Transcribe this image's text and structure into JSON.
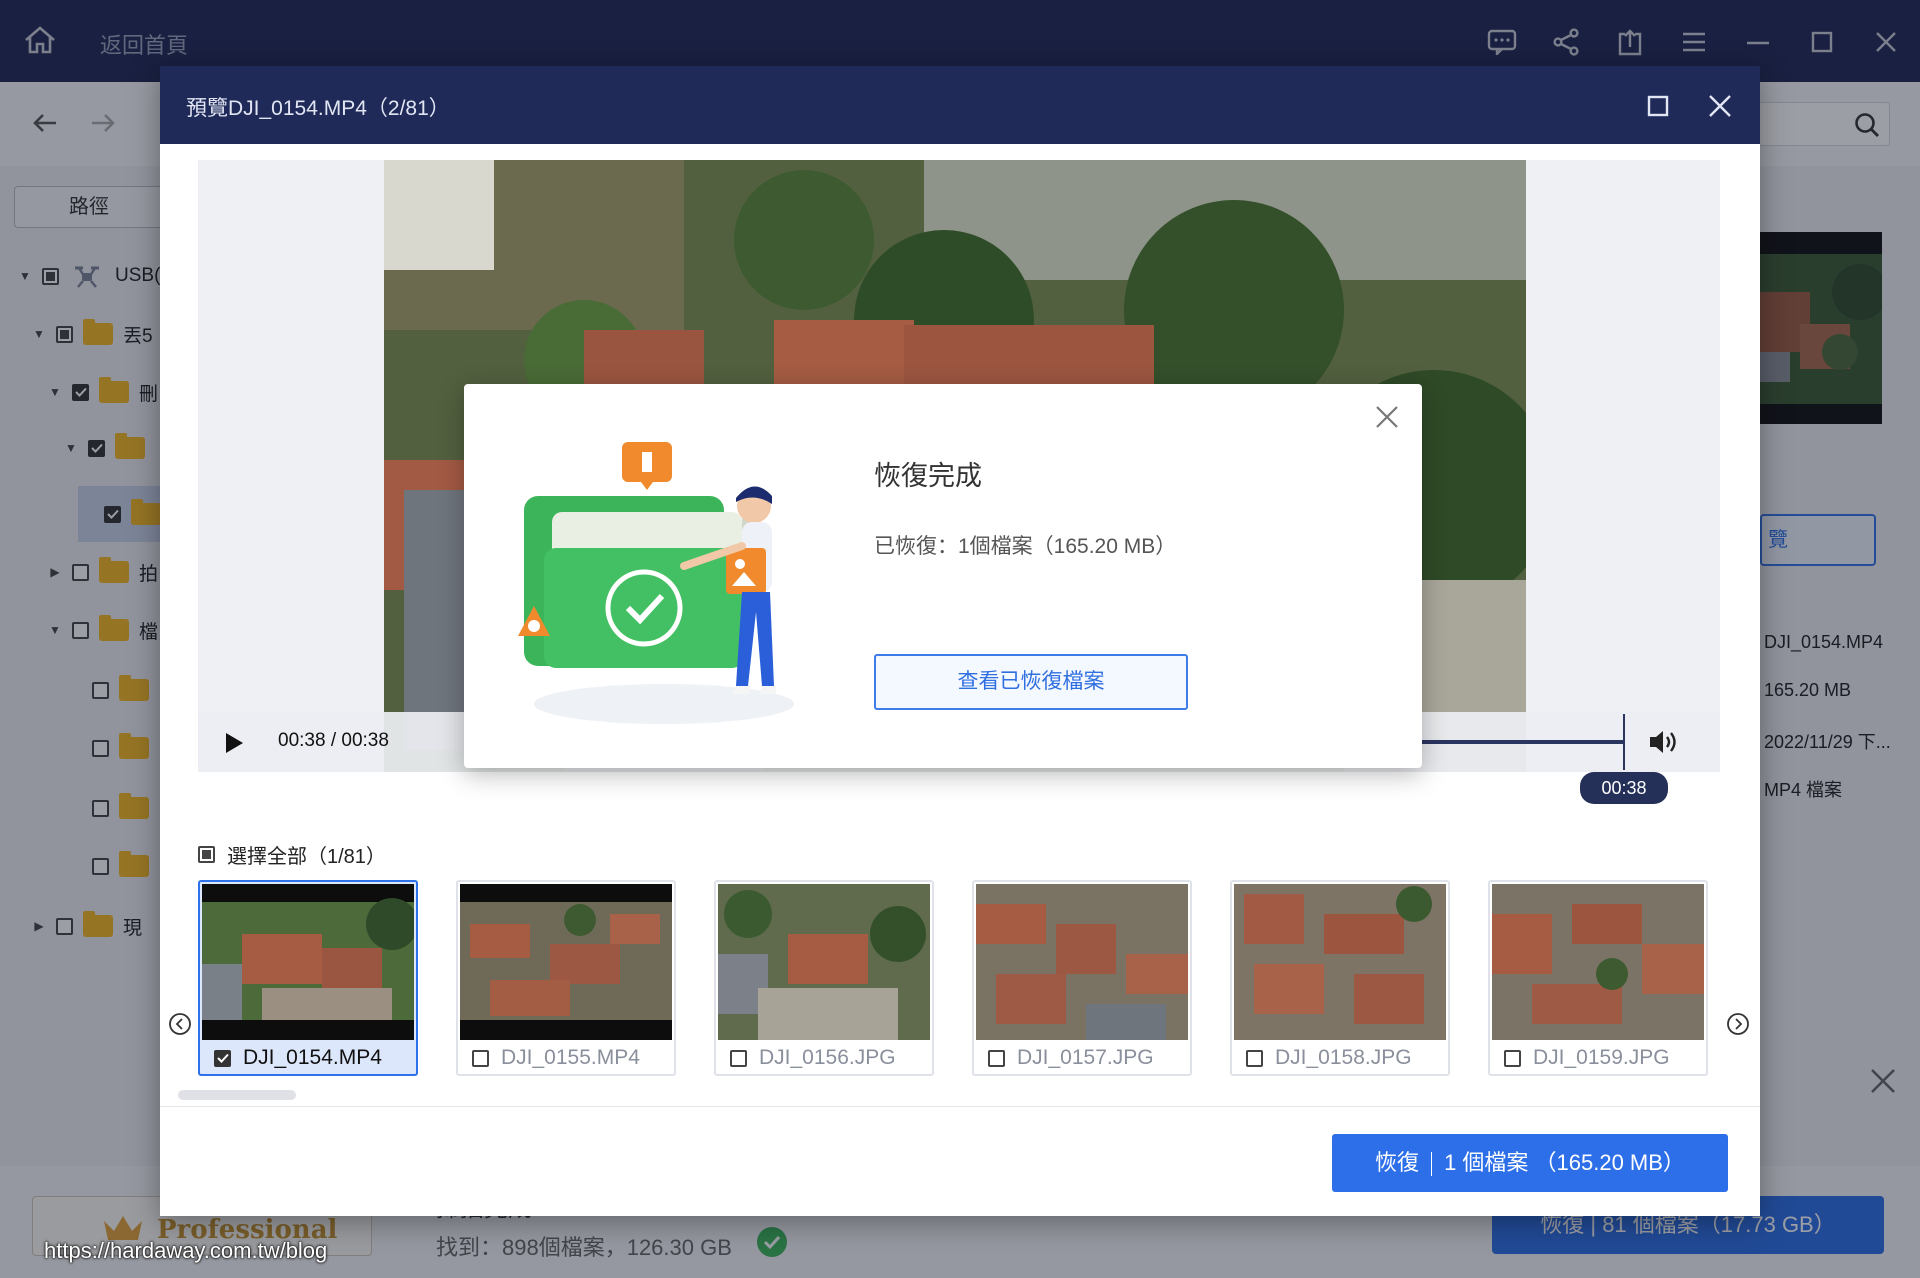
{
  "app": {
    "title": "返回首頁",
    "icons": [
      "feedback-icon",
      "share-icon",
      "export-icon",
      "menu-icon",
      "minimize-icon",
      "maximize-icon",
      "close-icon"
    ]
  },
  "sidebar": {
    "path_tab": "路徑",
    "tree": [
      {
        "label": "USB(",
        "level": 0,
        "state": "partial"
      },
      {
        "label": "丟5",
        "level": 1,
        "state": "partial"
      },
      {
        "label": "刪",
        "level": 2,
        "state": "checked"
      },
      {
        "label": "",
        "level": 3,
        "state": "checked"
      },
      {
        "label": "",
        "level": 4,
        "state": "checked"
      },
      {
        "label": "拍",
        "level": 2,
        "state": "empty"
      },
      {
        "label": "檔",
        "level": 2,
        "state": "empty"
      },
      {
        "label": "",
        "level": 3,
        "state": "empty"
      },
      {
        "label": "",
        "level": 3,
        "state": "empty"
      },
      {
        "label": "",
        "level": 3,
        "state": "empty"
      },
      {
        "label": "",
        "level": 3,
        "state": "empty"
      },
      {
        "label": "現",
        "level": 1,
        "state": "empty"
      }
    ]
  },
  "right_panel": {
    "button_label": "覽",
    "file_name": "DJI_0154.MP4",
    "file_size": "165.20 MB",
    "file_date": "2022/11/29 下...",
    "file_type": "MP4 檔案"
  },
  "bottom": {
    "edition": "Professional",
    "scan_title": "掃描完成",
    "scan_found": "找到：898個檔案，126.30 GB",
    "recover_all": "恢復 | 81 個檔案（17.73 GB）",
    "watermark": "https://hardaway.com.tw/blog"
  },
  "preview": {
    "title": "預覽DJI_0154.MP4（2/81）",
    "time_display": "00:38 / 00:38",
    "time_bubble": "00:38",
    "playback_progress": 1.0,
    "select_all": "選擇全部（1/81）",
    "files": [
      {
        "name": "DJI_0154.MP4",
        "checked": true
      },
      {
        "name": "DJI_0155.MP4",
        "checked": false
      },
      {
        "name": "DJI_0156.JPG",
        "checked": false
      },
      {
        "name": "DJI_0157.JPG",
        "checked": false
      },
      {
        "name": "DJI_0158.JPG",
        "checked": false
      },
      {
        "name": "DJI_0159.JPG",
        "checked": false
      }
    ],
    "recover_button": {
      "action": "恢復",
      "detail": "1 個檔案 （165.20 MB）"
    }
  },
  "done_dialog": {
    "title": "恢復完成",
    "info": "已恢復：1個檔案（165.20 MB）",
    "view_button": "查看已恢復檔案"
  },
  "colors": {
    "header_navy": "#1f2a59",
    "accent_blue": "#2d6fe8",
    "folder_yellow": "#f3b721",
    "success_green": "#3cb55a"
  }
}
